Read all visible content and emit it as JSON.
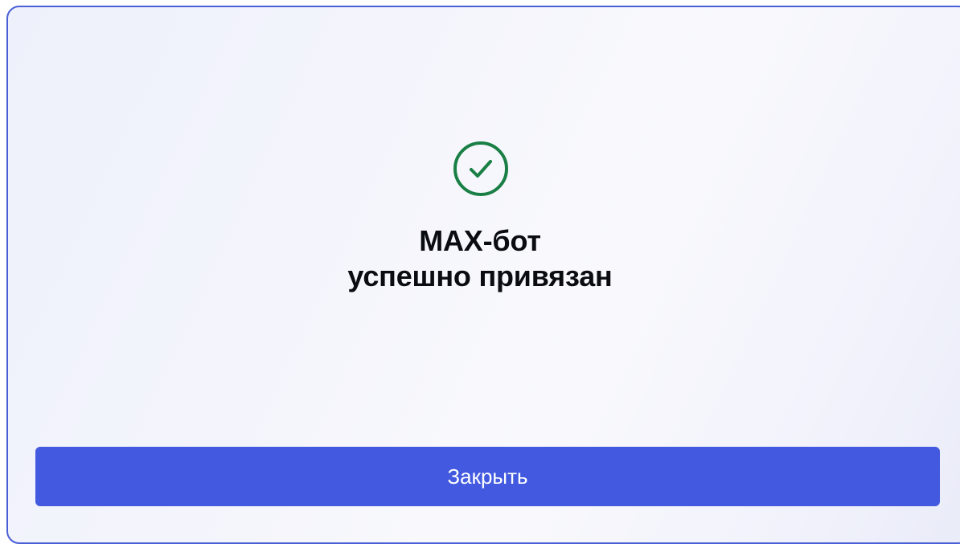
{
  "dialog": {
    "icon": "check-circle-icon",
    "title_line_1": "MAX-бот",
    "title_line_2": "успешно привязан",
    "close_label": "Закрыть"
  },
  "colors": {
    "accent": "#435ae0",
    "success": "#1a7f45",
    "border": "#4a5fd6",
    "text": "#0b0b12"
  }
}
